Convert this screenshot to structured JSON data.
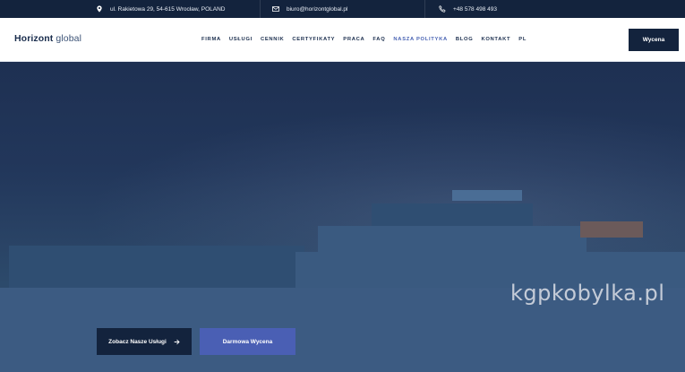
{
  "topbar": {
    "address": "ul. Rakietowa 29, 54-615 Wrocław, POLAND",
    "email": "biuro@horizontglobal.pl",
    "phone": "+48 578 498 493"
  },
  "brand": {
    "logo_bold": "Horizont",
    "logo_light": "global"
  },
  "nav": {
    "items": [
      "FIRMA",
      "USŁUGI",
      "CENNIK",
      "CERTYFIKATY",
      "PRACA",
      "FAQ",
      "NASZA POLITYKA",
      "BLOG",
      "KONTAKT",
      "PL"
    ],
    "active_item": "NASZA POLITYKA",
    "quote_button": "Wycena"
  },
  "hero": {
    "primary_button": "Zobacz Nasze Usługi",
    "secondary_button": "Darmowa Wycena"
  },
  "watermark": "kgpkobylka.pl",
  "colors": {
    "navy": "#13233d",
    "accent": "#4a5fb4",
    "active_nav": "#4a64b4"
  },
  "icons": {
    "address": "map-pin-icon",
    "email": "envelope-icon",
    "phone": "phone-icon",
    "cta": "arrow-right-icon"
  }
}
